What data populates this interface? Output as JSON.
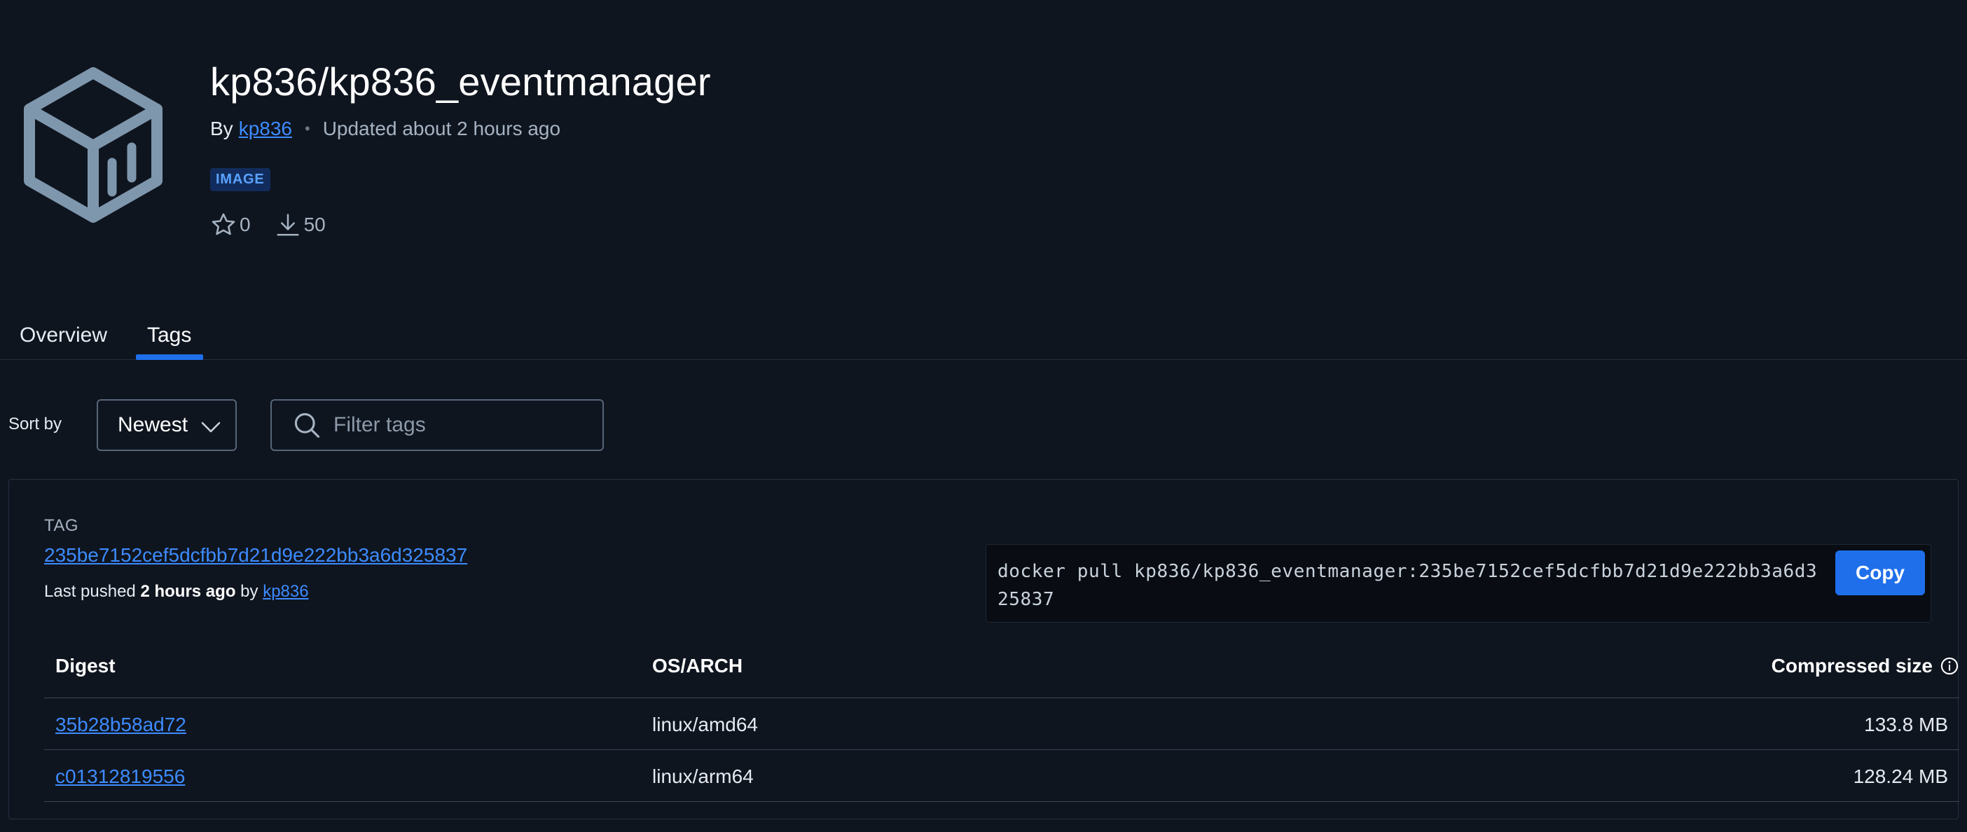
{
  "repo": {
    "title": "kp836/kp836_eventmanager",
    "by_label": "By",
    "owner": "kp836",
    "updated": "Updated about 2 hours ago",
    "badge": "IMAGE",
    "stars": "0",
    "downloads": "50"
  },
  "tabs": [
    {
      "label": "Overview",
      "active": false
    },
    {
      "label": "Tags",
      "active": true
    }
  ],
  "controls": {
    "sort_label": "Sort by",
    "sort_value": "Newest",
    "filter_placeholder": "Filter tags"
  },
  "tag": {
    "heading": "TAG",
    "name": "235be7152cef5dcfbb7d21d9e222bb3a6d325837",
    "pushed_prefix": "Last pushed",
    "pushed_time": "2 hours ago",
    "pushed_by": "by",
    "pushed_user": "kp836",
    "pull_command": "docker pull kp836/kp836_eventmanager:235be7152cef5dcfbb7d21d9e222bb3a6d325837",
    "copy_label": "Copy"
  },
  "table": {
    "headers": {
      "digest": "Digest",
      "os_arch": "OS/ARCH",
      "size": "Compressed size"
    },
    "rows": [
      {
        "digest": "35b28b58ad72",
        "os_arch": "linux/amd64",
        "size": "133.8 MB"
      },
      {
        "digest": "c01312819556",
        "os_arch": "linux/arm64",
        "size": "128.24 MB"
      }
    ]
  },
  "colors": {
    "background": "#0f151f",
    "accent": "#1f6feb",
    "link": "#3d8bff",
    "logo": "#7f97ad"
  },
  "icons": [
    "docker-image-logo-icon",
    "star-icon",
    "download-icon",
    "chevron-down-icon",
    "search-icon",
    "info-icon"
  ]
}
